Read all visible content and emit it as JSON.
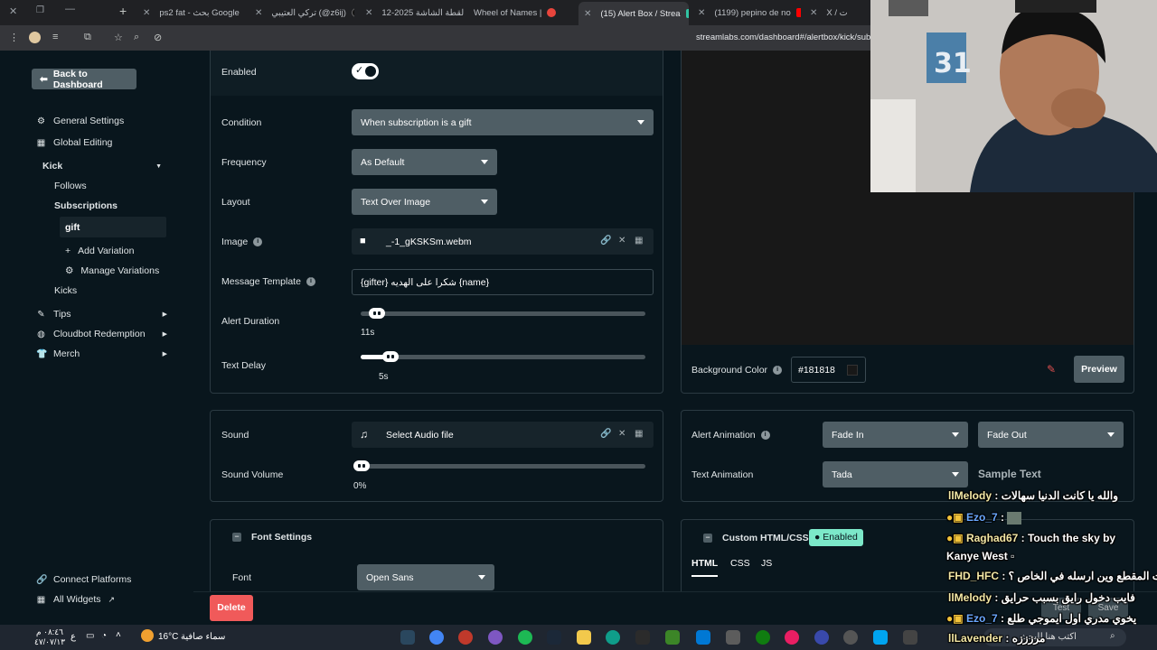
{
  "browser": {
    "tabs": [
      {
        "label": "ps2 fat - بحث Google",
        "color": "#ffffff"
      },
      {
        "label": "تركي العتيبي (@z6ij)",
        "color": "#111111"
      },
      {
        "label": "لقطة الشاشة 2025-12",
        "color": "#777777"
      },
      {
        "label": "Wheel of Names |",
        "color": "#e8453c"
      },
      {
        "label": "(15) Alert Box / Strea",
        "color": "#31c3a2"
      },
      {
        "label": "(1199) pepino de no",
        "color": "#ff0000"
      },
      {
        "label": "X / ت",
        "color": "#000000"
      }
    ],
    "url": "streamlabs.com/dashboard#/alertbox/kick/sub"
  },
  "sidebar": {
    "back_label": "Back to Dashboard",
    "items": [
      {
        "label": "General Settings",
        "icon": "gear-icon"
      },
      {
        "label": "Global Editing",
        "icon": "grid-icon"
      }
    ],
    "kick": {
      "label": "Kick",
      "follows": "Follows",
      "subscriptions": "Subscriptions",
      "gift": "gift",
      "add_variation": "Add Variation",
      "manage_variations": "Manage Variations",
      "kicks": "Kicks"
    },
    "more": [
      {
        "label": "Tips",
        "icon": "tag-icon"
      },
      {
        "label": "Cloudbot Redemption",
        "icon": "bot-icon"
      },
      {
        "label": "Merch",
        "icon": "shirt-icon"
      }
    ],
    "connect": "Connect Platforms",
    "widgets": "All Widgets"
  },
  "settings": {
    "enabled_label": "Enabled",
    "enabled": true,
    "condition_label": "Condition",
    "condition_value": "When subscription is a gift",
    "frequency_label": "Frequency",
    "frequency_value": "As Default",
    "layout_label": "Layout",
    "layout_value": "Text Over Image",
    "image_label": "Image",
    "image_file": "_-1_gKSKSm.webm",
    "message_label": "Message Template",
    "message_value": "{gifter} شكرا على الهديه {name}",
    "duration_label": "Alert Duration",
    "duration_value": "11s",
    "duration_fraction": 0.03,
    "delay_label": "Text Delay",
    "delay_value": "5s",
    "delay_fraction": 0.08
  },
  "sound": {
    "sound_label": "Sound",
    "sound_file": "Select Audio file",
    "volume_label": "Sound Volume",
    "volume_value": "0%",
    "volume_fraction": 0.0
  },
  "font": {
    "title": "Font Settings",
    "font_label": "Font",
    "font_value": "Open Sans"
  },
  "preview": {
    "bg_label": "Background Color",
    "bg_value": "#181818",
    "preview_btn": "Preview"
  },
  "animation": {
    "alert_label": "Alert Animation",
    "alert_in": "Fade In",
    "alert_out": "Fade Out",
    "text_label": "Text Animation",
    "text_value": "Tada",
    "sample": "Sample Text"
  },
  "custom": {
    "title": "Custom HTML/CSS",
    "badge": "Enabled",
    "tabs": [
      "HTML",
      "CSS",
      "JS"
    ]
  },
  "delete_label": "Delete",
  "overlay_buttons": {
    "test": "Test",
    "save": "Save"
  },
  "chat": [
    {
      "user": "llMelody",
      "text": "والله يا كانت الدنيا سهالات",
      "color": "u-y"
    },
    {
      "user": "Ezo_7",
      "text": "",
      "color": "u-b"
    },
    {
      "user": "Raghad67",
      "text": "Touch the sky by",
      "color": "u-y"
    },
    {
      "user": "",
      "text": "Kanye West",
      "color": "u-y"
    },
    {
      "user": "FHD_HFC",
      "text": "فت المقطع وين ارسله في الخاص ؟",
      "color": "u-y"
    },
    {
      "user": "llMelody",
      "text": "فايب دخول رايق بسبب حرايق",
      "color": "u-y"
    },
    {
      "user": "Ezo_7",
      "text": "يخوي مدري اول ايموجي طلع",
      "color": "u-b"
    },
    {
      "user": "llLavender",
      "text": "مرزززه",
      "color": "u-y"
    }
  ],
  "taskbar": {
    "time": "٠٨:٤٦ م",
    "date": "٤٧/٠٧/١٣",
    "weather_temp": "16°C",
    "weather_text": "سماء صافية",
    "lang": "ع",
    "search_placeholder": "اكتب هنا للبحث"
  }
}
